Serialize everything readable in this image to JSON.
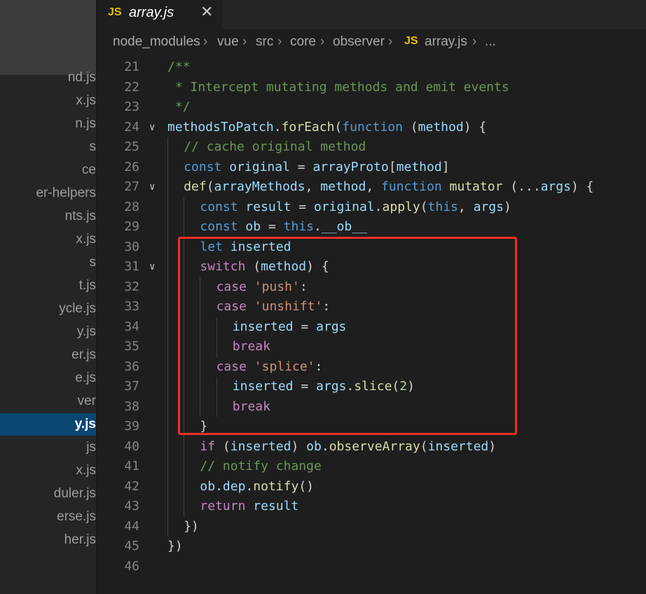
{
  "sidebar": {
    "files": [
      {
        "label": "nd.js",
        "active": false
      },
      {
        "label": "x.js",
        "active": false
      },
      {
        "label": "n.js",
        "active": false
      },
      {
        "label": "s",
        "active": false
      },
      {
        "label": "ce",
        "active": false
      },
      {
        "label": "er-helpers",
        "active": false
      },
      {
        "label": "nts.js",
        "active": false
      },
      {
        "label": "x.js",
        "active": false
      },
      {
        "label": "s",
        "active": false
      },
      {
        "label": "t.js",
        "active": false
      },
      {
        "label": "ycle.js",
        "active": false
      },
      {
        "label": "y.js",
        "active": false
      },
      {
        "label": "er.js",
        "active": false
      },
      {
        "label": "e.js",
        "active": false
      },
      {
        "label": "ver",
        "active": false
      },
      {
        "label": "y.js",
        "active": true
      },
      {
        "label": "js",
        "active": false
      },
      {
        "label": "x.js",
        "active": false
      },
      {
        "label": "duler.js",
        "active": false
      },
      {
        "label": "erse.js",
        "active": false
      },
      {
        "label": "her.js",
        "active": false
      }
    ]
  },
  "tab": {
    "badge": "JS",
    "title": "array.js",
    "close": "✕"
  },
  "breadcrumb": {
    "items": [
      "node_modules",
      "vue",
      "src",
      "core",
      "observer"
    ],
    "file_badge": "JS",
    "file": "array.js",
    "more": "...",
    "separator": "›"
  },
  "editor": {
    "lines": [
      {
        "n": "21",
        "fold": false,
        "indent": 0,
        "tokens": [
          [
            "/**",
            "comment"
          ]
        ]
      },
      {
        "n": "22",
        "fold": false,
        "indent": 0,
        "tokens": [
          [
            " * Intercept mutating methods and emit events",
            "comment"
          ]
        ]
      },
      {
        "n": "23",
        "fold": false,
        "indent": 0,
        "tokens": [
          [
            " */",
            "comment"
          ]
        ]
      },
      {
        "n": "24",
        "fold": true,
        "indent": 0,
        "tokens": [
          [
            "methodsToPatch",
            "var"
          ],
          [
            ".",
            "plain"
          ],
          [
            "forEach",
            "func"
          ],
          [
            "(",
            "plain"
          ],
          [
            "function",
            "keyword"
          ],
          [
            " (",
            "plain"
          ],
          [
            "method",
            "var"
          ],
          [
            ") {",
            "plain"
          ]
        ]
      },
      {
        "n": "25",
        "fold": false,
        "indent": 1,
        "tokens": [
          [
            "// cache original method",
            "comment"
          ]
        ]
      },
      {
        "n": "26",
        "fold": false,
        "indent": 1,
        "tokens": [
          [
            "const",
            "keyword"
          ],
          [
            " ",
            "plain"
          ],
          [
            "original",
            "var"
          ],
          [
            " = ",
            "plain"
          ],
          [
            "arrayProto",
            "var"
          ],
          [
            "[",
            "plain"
          ],
          [
            "method",
            "var"
          ],
          [
            "]",
            "plain"
          ]
        ]
      },
      {
        "n": "27",
        "fold": true,
        "indent": 1,
        "tokens": [
          [
            "def",
            "func"
          ],
          [
            "(",
            "plain"
          ],
          [
            "arrayMethods",
            "var"
          ],
          [
            ", ",
            "plain"
          ],
          [
            "method",
            "var"
          ],
          [
            ", ",
            "plain"
          ],
          [
            "function",
            "keyword"
          ],
          [
            " ",
            "plain"
          ],
          [
            "mutator",
            "func"
          ],
          [
            " (...",
            "plain"
          ],
          [
            "args",
            "var"
          ],
          [
            ") {",
            "plain"
          ]
        ]
      },
      {
        "n": "28",
        "fold": false,
        "indent": 2,
        "tokens": [
          [
            "const",
            "keyword"
          ],
          [
            " ",
            "plain"
          ],
          [
            "result",
            "var"
          ],
          [
            " = ",
            "plain"
          ],
          [
            "original",
            "var"
          ],
          [
            ".",
            "plain"
          ],
          [
            "apply",
            "func"
          ],
          [
            "(",
            "plain"
          ],
          [
            "this",
            "keyword"
          ],
          [
            ", ",
            "plain"
          ],
          [
            "args",
            "var"
          ],
          [
            ")",
            "plain"
          ]
        ]
      },
      {
        "n": "29",
        "fold": false,
        "indent": 2,
        "tokens": [
          [
            "const",
            "keyword"
          ],
          [
            " ",
            "plain"
          ],
          [
            "ob",
            "var"
          ],
          [
            " = ",
            "plain"
          ],
          [
            "this",
            "keyword"
          ],
          [
            ".",
            "plain"
          ],
          [
            "__ob__",
            "var"
          ]
        ]
      },
      {
        "n": "30",
        "fold": false,
        "indent": 2,
        "tokens": [
          [
            "let",
            "keyword"
          ],
          [
            " ",
            "plain"
          ],
          [
            "inserted",
            "var"
          ]
        ]
      },
      {
        "n": "31",
        "fold": true,
        "indent": 2,
        "tokens": [
          [
            "switch",
            "control"
          ],
          [
            " (",
            "plain"
          ],
          [
            "method",
            "var"
          ],
          [
            ") {",
            "plain"
          ]
        ]
      },
      {
        "n": "32",
        "fold": false,
        "indent": 3,
        "tokens": [
          [
            "case",
            "control"
          ],
          [
            " ",
            "plain"
          ],
          [
            "'push'",
            "string"
          ],
          [
            ":",
            "plain"
          ]
        ]
      },
      {
        "n": "33",
        "fold": false,
        "indent": 3,
        "tokens": [
          [
            "case",
            "control"
          ],
          [
            " ",
            "plain"
          ],
          [
            "'unshift'",
            "string"
          ],
          [
            ":",
            "plain"
          ]
        ]
      },
      {
        "n": "34",
        "fold": false,
        "indent": 4,
        "tokens": [
          [
            "inserted",
            "var"
          ],
          [
            " = ",
            "plain"
          ],
          [
            "args",
            "var"
          ]
        ]
      },
      {
        "n": "35",
        "fold": false,
        "indent": 4,
        "tokens": [
          [
            "break",
            "control"
          ]
        ]
      },
      {
        "n": "36",
        "fold": false,
        "indent": 3,
        "tokens": [
          [
            "case",
            "control"
          ],
          [
            " ",
            "plain"
          ],
          [
            "'splice'",
            "string"
          ],
          [
            ":",
            "plain"
          ]
        ]
      },
      {
        "n": "37",
        "fold": false,
        "indent": 4,
        "tokens": [
          [
            "inserted",
            "var"
          ],
          [
            " = ",
            "plain"
          ],
          [
            "args",
            "var"
          ],
          [
            ".",
            "plain"
          ],
          [
            "slice",
            "func"
          ],
          [
            "(",
            "plain"
          ],
          [
            "2",
            "number"
          ],
          [
            ")",
            "plain"
          ]
        ]
      },
      {
        "n": "38",
        "fold": false,
        "indent": 4,
        "tokens": [
          [
            "break",
            "control"
          ]
        ]
      },
      {
        "n": "39",
        "fold": false,
        "indent": 2,
        "tokens": [
          [
            "}",
            "plain"
          ]
        ]
      },
      {
        "n": "40",
        "fold": false,
        "indent": 2,
        "tokens": [
          [
            "if",
            "control"
          ],
          [
            " (",
            "plain"
          ],
          [
            "inserted",
            "var"
          ],
          [
            ") ",
            "plain"
          ],
          [
            "ob",
            "var"
          ],
          [
            ".",
            "plain"
          ],
          [
            "observeArray",
            "func"
          ],
          [
            "(",
            "plain"
          ],
          [
            "inserted",
            "var"
          ],
          [
            ")",
            "plain"
          ]
        ]
      },
      {
        "n": "41",
        "fold": false,
        "indent": 2,
        "tokens": [
          [
            "// notify change",
            "comment"
          ]
        ]
      },
      {
        "n": "42",
        "fold": false,
        "indent": 2,
        "tokens": [
          [
            "ob",
            "var"
          ],
          [
            ".",
            "plain"
          ],
          [
            "dep",
            "var"
          ],
          [
            ".",
            "plain"
          ],
          [
            "notify",
            "func"
          ],
          [
            "()",
            "plain"
          ]
        ]
      },
      {
        "n": "43",
        "fold": false,
        "indent": 2,
        "tokens": [
          [
            "return",
            "control"
          ],
          [
            " ",
            "plain"
          ],
          [
            "result",
            "var"
          ]
        ]
      },
      {
        "n": "44",
        "fold": false,
        "indent": 1,
        "tokens": [
          [
            "})",
            "plain"
          ]
        ]
      },
      {
        "n": "45",
        "fold": false,
        "indent": 0,
        "tokens": [
          [
            "})",
            "plain"
          ]
        ]
      },
      {
        "n": "46",
        "fold": false,
        "indent": 0,
        "tokens": []
      }
    ]
  },
  "colors": {
    "highlight_box": "#e8312a",
    "active_file_bg": "#094771",
    "js_badge": "#e8c000"
  }
}
